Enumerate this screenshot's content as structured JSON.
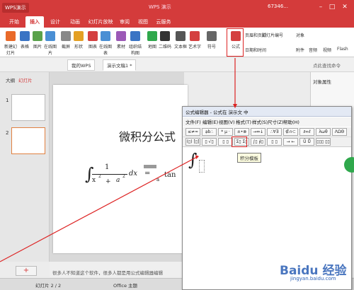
{
  "app": {
    "brand": "WPS演示",
    "title": "WPS 演示",
    "user": "67346..."
  },
  "menu_tabs": [
    "开始",
    "插入",
    "设计",
    "动画",
    "幻灯片放映",
    "审阅",
    "视图",
    "云服务"
  ],
  "active_tab": "插入",
  "ribbon": {
    "buttons": [
      {
        "label": "新建幻灯片",
        "color": "#e96a2a"
      },
      {
        "label": "表格",
        "color": "#3a74c4"
      },
      {
        "label": "图片",
        "color": "#5aa24a"
      },
      {
        "label": "在线图片",
        "color": "#4a8fd4"
      },
      {
        "label": "截屏",
        "color": "#888888"
      },
      {
        "label": "形状",
        "color": "#e4a024"
      },
      {
        "label": "图表",
        "color": "#d44040"
      },
      {
        "label": "在线图表",
        "color": "#4a8fd4"
      },
      {
        "label": "素材",
        "color": "#9b59b6"
      },
      {
        "label": "组织结构图",
        "color": "#3a74c4"
      },
      {
        "label": "地图",
        "color": "#2fa84c"
      },
      {
        "label": "二维码",
        "color": "#333333"
      },
      {
        "label": "文本框",
        "color": "#555555"
      },
      {
        "label": "艺术字",
        "color": "#d44040"
      },
      {
        "label": "符号",
        "color": "#666666"
      },
      {
        "label": "公式",
        "color": "#d44040"
      },
      {
        "label": "页眉和页脚",
        "color": "#3a74c4"
      },
      {
        "label": "日期和时间",
        "color": "#3a74c4"
      }
    ],
    "right_items": [
      "幻灯片编号",
      "对象",
      "附件",
      "音频",
      "视频",
      "Flash"
    ]
  },
  "doc_tabs": [
    "我的WPS",
    "演示文稿1 *"
  ],
  "search_placeholder": "点此查找命令",
  "left_panel": {
    "tabs": [
      "大纲",
      "幻灯片"
    ],
    "slides": [
      "1",
      "2"
    ]
  },
  "slide": {
    "title": "微积分公式",
    "formula_num": "1",
    "formula_den1": "x",
    "formula_den2": "a",
    "exp1": "2",
    "exp2": "2",
    "plus": "+",
    "dx": "dx",
    "eq": "=",
    "rhs_den": "a",
    "rhs_fn": "tan"
  },
  "notes": "很多人不知道这个软件，很多人都是用公式编辑器编辑",
  "status": {
    "slide_count": "幻灯片 2 / 2",
    "theme": "Office 主题"
  },
  "right_panel": {
    "title": "对象属性"
  },
  "equation_editor": {
    "title": "公式编辑器 - 公式在 演示文 中",
    "menus": [
      "文件(F)",
      "编辑(E)",
      "视图(V)",
      "格式(T)",
      "样式(S)",
      "尺寸(Z)",
      "帮助(H)"
    ],
    "toolbar1": [
      "≤≠≈",
      "ạb∴",
      "* μ ·",
      "±•⊗",
      "→⇔↓",
      "∴∀∃",
      "∉∩⊂",
      "∂∞ℓ",
      "λωθ",
      "ΛΩΘ"
    ],
    "toolbar2": [
      "(▯) [▯]",
      "▯ √▯",
      "▯ ▯",
      "Σ▯ Σ▯",
      "∫▯ ∮▯",
      "▯ ▯",
      "→ ←",
      "Ū Ů",
      "▯▯▯ ▯▯"
    ],
    "tooltip": "积分模板"
  },
  "watermark": {
    "text": "Baidu 经验",
    "sub": "jingyan.baidu.com"
  },
  "colors": {
    "accent": "#d43b3b",
    "annotation": "#dd2222"
  }
}
